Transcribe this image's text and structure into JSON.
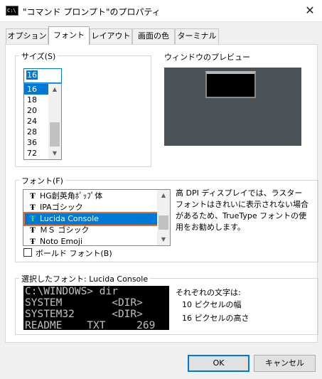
{
  "window": {
    "title": "\"コマンド プロンプト\"のプロパティ",
    "icon_label": "C:\\",
    "close_glyph": "✕"
  },
  "tabs": [
    {
      "label": "オプション",
      "active": false
    },
    {
      "label": "フォント",
      "active": true
    },
    {
      "label": "レイアウト",
      "active": false
    },
    {
      "label": "画面の色",
      "active": false
    },
    {
      "label": "ターミナル",
      "active": false
    }
  ],
  "size_group": {
    "label": "サイズ(S)",
    "input_value": "16",
    "items": [
      "16",
      "18",
      "20",
      "24",
      "28",
      "36",
      "72"
    ],
    "selected": "16"
  },
  "preview": {
    "label": "ウィンドウのプレビュー"
  },
  "font_group": {
    "label": "フォント(F)",
    "items": [
      "HG創英角ﾎﾟｯﾌﾟ体",
      "IPAゴシック",
      "Lucida Console",
      "ＭＳ ゴシック",
      "Noto Emoji"
    ],
    "selected": "Lucida Console",
    "dpi_note": "高 DPI ディスプレイでは、ラスター フォントはきれいに表示されない場合があるため、TrueType フォントの使用をお勧めします。",
    "bold_label": "ボールド フォント(B)",
    "bold_checked": false
  },
  "selected_font": {
    "label": "選択したフォント: Lucida Console",
    "sample_lines": [
      "C:\\WINDOWS> dir",
      "SYSTEM        <DIR>",
      "SYSTEM32      <DIR>",
      "README    TXT     269"
    ],
    "char_label": "それぞれの文字は:",
    "char_width": "10 ピクセルの幅",
    "char_height": "16 ピクセルの高さ"
  },
  "buttons": {
    "ok": "OK",
    "cancel": "キャンセル"
  },
  "icons": {
    "tt_glyph": "Ŧ",
    "up_arrow": "▲",
    "down_arrow": "▼"
  },
  "colors": {
    "accent": "#0078d7",
    "focus_outline": "#e46f24",
    "preview_bg": "#4b5258"
  }
}
